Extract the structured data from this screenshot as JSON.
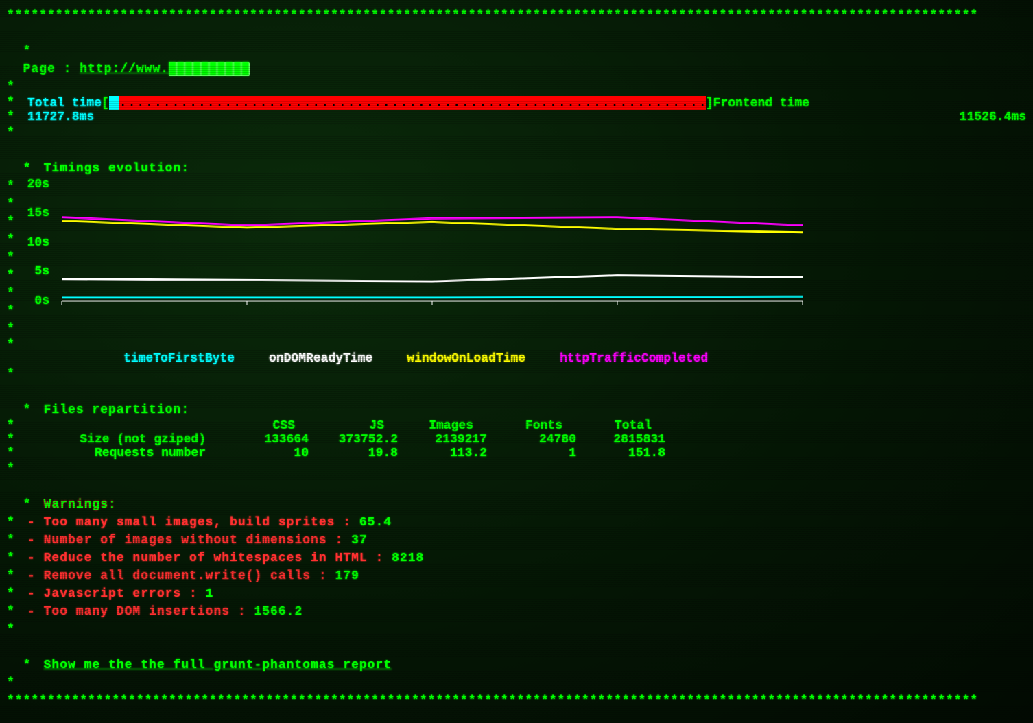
{
  "border_char": "*",
  "page_label": "Page : ",
  "page_url_visible": "http://www.",
  "page_url_blurred": "██████████",
  "total_time_label": "Total time",
  "total_time_value": "11727.8ms",
  "frontend_time_label": "Frontend time",
  "frontend_time_value": "11526.4ms",
  "bar_total_ms": 11727.8,
  "bar_backend_ms": 201.4,
  "bar_frontend_ms": 11526.4,
  "timings_title": "Timings evolution:",
  "chart_data": {
    "type": "line",
    "y_ticks": [
      0,
      5,
      10,
      15,
      20
    ],
    "y_ticks_labels": [
      "0s",
      "5s",
      "10s",
      "15s",
      "20s"
    ],
    "ylim": [
      0,
      20
    ],
    "x_points": 5,
    "series": [
      {
        "name": "timeToFirstByte",
        "color": "#00ffff",
        "values": [
          0.6,
          0.6,
          0.6,
          0.7,
          0.8
        ]
      },
      {
        "name": "onDOMReadyTime",
        "color": "#ffffff",
        "values": [
          3.8,
          3.6,
          3.4,
          4.4,
          4.1
        ]
      },
      {
        "name": "windowOnLoadTime",
        "color": "#ffff00",
        "values": [
          13.8,
          12.6,
          13.6,
          12.4,
          11.8
        ]
      },
      {
        "name": "httpTrafficCompleted",
        "color": "#ff00ff",
        "values": [
          14.4,
          13.0,
          14.2,
          14.4,
          13.0
        ]
      }
    ]
  },
  "legend": [
    {
      "label": "timeToFirstByte",
      "color_class": "cyan"
    },
    {
      "label": "onDOMReadyTime",
      "color_class": "white"
    },
    {
      "label": "windowOnLoadTime",
      "color_class": "yellow"
    },
    {
      "label": "httpTrafficCompleted",
      "color_class": "magenta"
    }
  ],
  "files_title": "Files repartition:",
  "files_headers": [
    "CSS",
    "JS",
    "Images",
    "Fonts",
    "Total"
  ],
  "files_rows": [
    {
      "label": "Size (not gziped)",
      "values": [
        "133664",
        "373752.2",
        "2139217",
        "24780",
        "2815831"
      ]
    },
    {
      "label": "Requests number",
      "values": [
        "10",
        "19.8",
        "113.2",
        "1",
        "151.8"
      ]
    }
  ],
  "warnings_title": "Warnings:",
  "warnings": [
    {
      "text": "- Too many small images, build sprites : ",
      "value": "65.4"
    },
    {
      "text": "- Number of images without dimensions : ",
      "value": "37"
    },
    {
      "text": "- Reduce the number of whitespaces in HTML : ",
      "value": "8218"
    },
    {
      "text": "- Remove all document.write() calls : ",
      "value": "179"
    },
    {
      "text": "- Javascript errors : ",
      "value": "1"
    },
    {
      "text": "- Too many DOM insertions : ",
      "value": "1566.2"
    }
  ],
  "report_link": "Show me the the full grunt-phantomas report"
}
